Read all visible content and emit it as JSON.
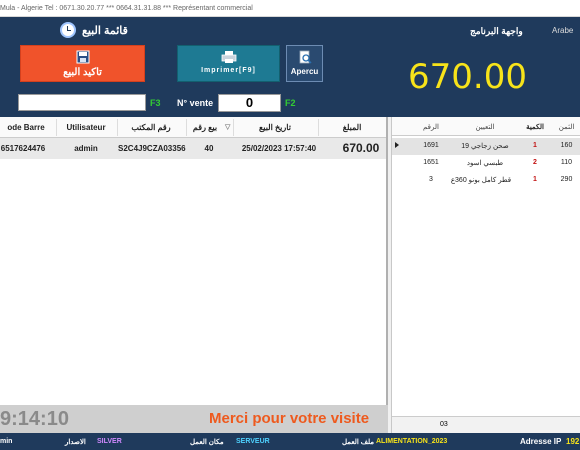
{
  "window": {
    "titlebar_text": "Mula - Algerie Tel : 0671.30.20.77  *** 0664.31.31.88  ***  Représentant commercial"
  },
  "header": {
    "title": "قائمة البيع",
    "interface_label": "واجهة البرنامج",
    "language": "Arabe"
  },
  "toolbar": {
    "confirm_label": "تاكيد البيع",
    "print_label": "Imprimer[F9]",
    "preview_label": "Apercu",
    "total": "670.00"
  },
  "inputs": {
    "barcode_value": "",
    "barcode_key": "F3",
    "vente_label": "N° vente",
    "vente_value": "0",
    "vente_key": "F2"
  },
  "sales_table": {
    "columns": [
      "ode Barre",
      "Utilisateur",
      "رقم المكتب",
      "بيع رقم",
      "تاريخ البيع",
      "المبلغ"
    ],
    "rows": [
      {
        "barcode": "6517624476",
        "user": "admin",
        "desk": "S2C4J9CZA03356",
        "sale_no": "40",
        "date": "25/02/2023 17:57:40",
        "amount": "670.00"
      }
    ]
  },
  "footer_left": {
    "time": "9:14:10",
    "thanks": "Merci pour votre visite"
  },
  "items_table": {
    "columns": [
      "الرقم",
      "التعيين",
      "الكمية",
      "الثمن"
    ],
    "rows": [
      {
        "num": "1691",
        "name": "صحن زجاجي 19",
        "qty": "1",
        "price": "160"
      },
      {
        "num": "1651",
        "name": "طبسي اسود",
        "qty": "2",
        "price": "110"
      },
      {
        "num": "3",
        "name": "قطر كامل بونو 360ع",
        "qty": "1",
        "price": "290"
      }
    ],
    "footer_count": "03"
  },
  "statusbar": {
    "user": "min",
    "version_label": "الاصدار",
    "version": "SILVER",
    "workplace_label": "مكان العمل",
    "workplace": "SERVEUR",
    "file_label": "ملف العمل",
    "file": "ALIMENTATION_2023",
    "ip_label": "Adresse IP",
    "ip": "192"
  },
  "colors": {
    "header_bg": "#1f3a5c",
    "confirm_button": "#f0532b",
    "print_button": "#1e7a93",
    "total_text": "#f7e31a",
    "thanks_text": "#ee5a1e",
    "hotkey_text": "#33cc33",
    "qty_text": "#c21212"
  }
}
